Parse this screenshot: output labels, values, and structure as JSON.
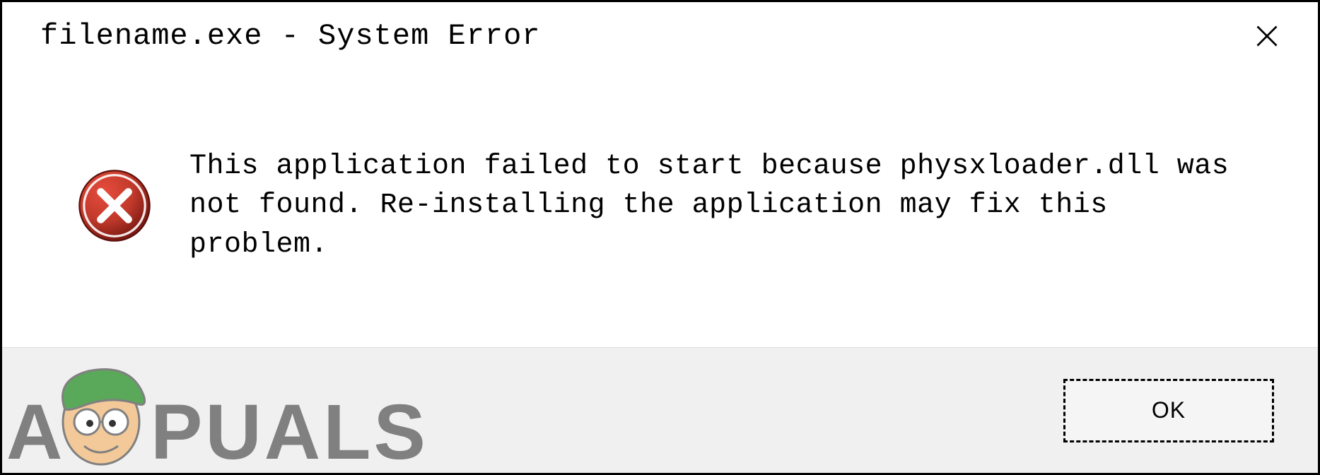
{
  "dialog": {
    "title": "filename.exe - System Error",
    "message": "This application failed to start because physxloader.dll was not found. Re-installing the application may fix this problem.",
    "ok_label": "OK",
    "icon_name": "error",
    "close_icon_name": "close"
  },
  "watermark": {
    "text": "A   PUALS"
  }
}
